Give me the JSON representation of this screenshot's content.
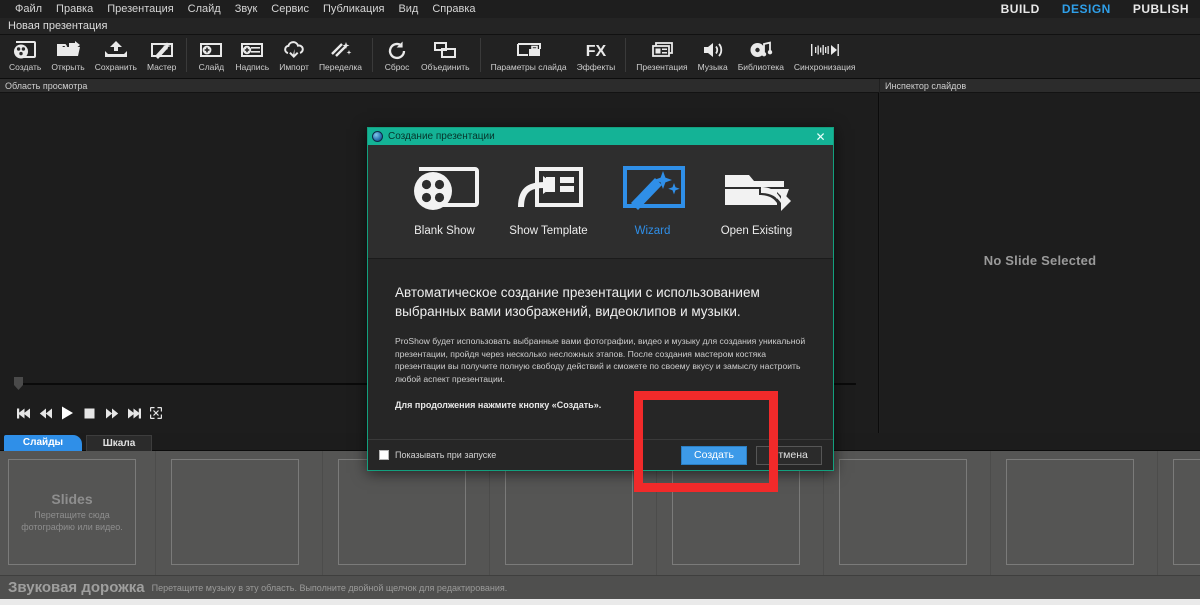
{
  "menu": {
    "items": [
      "Файл",
      "Правка",
      "Презентация",
      "Слайд",
      "Звук",
      "Сервис",
      "Публикация",
      "Вид",
      "Справка"
    ],
    "modes": [
      {
        "label": "BUILD",
        "active": false
      },
      {
        "label": "DESIGN",
        "active": true
      },
      {
        "label": "PUBLISH",
        "active": false
      }
    ]
  },
  "document": {
    "title": "Новая презентация"
  },
  "toolbar": {
    "groups": [
      {
        "buttons": [
          {
            "label": "Создать",
            "icon": "new-show-icon"
          },
          {
            "label": "Открыть",
            "icon": "open-folder-icon"
          },
          {
            "label": "Сохранить",
            "icon": "save-icon"
          },
          {
            "label": "Мастер",
            "icon": "wizard-wand-icon"
          }
        ]
      },
      {
        "buttons": [
          {
            "label": "Слайд",
            "icon": "add-slide-icon"
          },
          {
            "label": "Надпись",
            "icon": "add-caption-icon"
          },
          {
            "label": "Импорт",
            "icon": "cloud-import-icon"
          },
          {
            "label": "Переделка",
            "icon": "remix-icon"
          }
        ]
      },
      {
        "buttons": [
          {
            "label": "Сброс",
            "icon": "reset-icon"
          },
          {
            "label": "Объединить",
            "icon": "combine-icon"
          }
        ]
      },
      {
        "buttons": [
          {
            "label": "Параметры слайда",
            "icon": "slide-options-icon"
          },
          {
            "label": "Эффекты",
            "icon": "fx-icon"
          }
        ]
      },
      {
        "buttons": [
          {
            "label": "Презентация",
            "icon": "show-options-icon"
          },
          {
            "label": "Музыка",
            "icon": "speaker-icon"
          },
          {
            "label": "Библиотека",
            "icon": "music-library-icon"
          },
          {
            "label": "Синхронизация",
            "icon": "sync-icon"
          }
        ]
      }
    ]
  },
  "panels": {
    "preview_header": "Область просмотра",
    "inspector_header": "Инспектор слайдов",
    "inspector_empty": "No Slide Selected"
  },
  "transport": {
    "buttons": [
      {
        "name": "skip-start-icon"
      },
      {
        "name": "rewind-icon"
      },
      {
        "name": "play-icon"
      },
      {
        "name": "stop-icon"
      },
      {
        "name": "fast-forward-icon"
      },
      {
        "name": "skip-end-icon"
      },
      {
        "name": "fullscreen-icon"
      }
    ]
  },
  "bottom_tabs": [
    {
      "label": "Слайды",
      "active": true
    },
    {
      "label": "Шкала",
      "active": false
    }
  ],
  "slide_list": {
    "drop_title": "Slides",
    "drop_hint_line1": "Перетащите сюда",
    "drop_hint_line2": "фотографию или видео."
  },
  "soundtrack": {
    "title": "Звуковая дорожка",
    "hint": "Перетащите музыку в эту область. Выполните двойной щелчок для редактирования."
  },
  "dialog": {
    "title": "Создание презентации",
    "close_label": "✕",
    "choices": [
      {
        "label": "Blank Show",
        "icon": "blank-show-icon",
        "selected": false
      },
      {
        "label": "Show Template",
        "icon": "show-template-icon",
        "selected": false
      },
      {
        "label": "Wizard",
        "icon": "wizard-icon",
        "selected": true
      },
      {
        "label": "Open Existing",
        "icon": "open-existing-icon",
        "selected": false
      }
    ],
    "heading": "Автоматическое создание презентации с использованием выбранных вами изображений, видеоклипов и музыки.",
    "paragraph": "ProShow будет использовать выбранные вами фотографии, видео и музыку для создания уникальной презентации, пройдя через несколько несложных этапов. После создания мастером костяка презентации вы получите полную свободу действий и сможете по своему вкусу и замыслу настроить любой аспект презентации.",
    "call_to_action": "Для продолжения нажмите кнопку «Создать».",
    "checkbox_label": "Показывать при запуске",
    "checkbox_checked": false,
    "primary_button": "Создать",
    "secondary_button": "Отмена"
  },
  "annotation": {
    "color": "#f12a2a",
    "target": "Создать"
  },
  "colors": {
    "accent_blue": "#2f8fe8",
    "dialog_title_bar": "#14b396",
    "annotation_red": "#f12a2a",
    "panel_bg": "#1d1d1d",
    "slide_tray": "#555554"
  }
}
